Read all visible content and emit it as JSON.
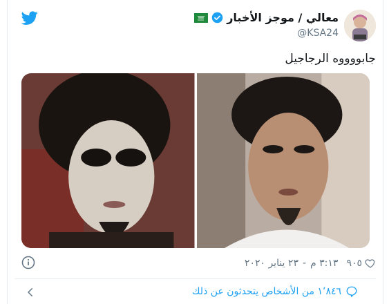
{
  "tweet": {
    "display_name": "معالي / موجز الأخبار",
    "handle": "@KSA24",
    "text": "جابووووه الرجاجيل",
    "likes": "٩٠٥",
    "time": "٣:١٣ م",
    "date": "٢٣ يناير ٢٠٢٠",
    "time_separator": "-",
    "conversation": "١٬٨٤٦ من الأشخاص يتحدثون عن ذلك"
  },
  "colors": {
    "accent": "#1da1f2",
    "text": "#14171a",
    "muted": "#657786"
  },
  "icons": [
    "twitter-bird-icon",
    "verified-badge-icon",
    "saudi-flag-icon",
    "heart-icon",
    "info-icon",
    "speech-bubble-icon",
    "chevron-left-icon"
  ]
}
